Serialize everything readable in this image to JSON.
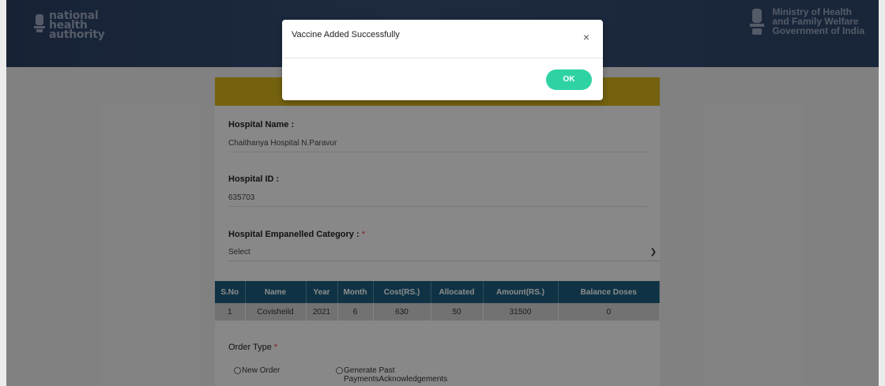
{
  "header": {
    "nha_logo_lines": [
      "national",
      "health",
      "authority"
    ],
    "ministry_lines": [
      "Ministry of Health",
      "and Family Welfare",
      "Government of India"
    ]
  },
  "form": {
    "hospital_name_label": "Hospital Name :",
    "hospital_name_value": "Chaithanya Hospital N.Paravur",
    "hospital_id_label": "Hospital ID :",
    "hospital_id_value": "635703",
    "category_label": "Hospital Empanelled Category :",
    "category_required": "*",
    "category_value": "Select",
    "table": {
      "headers": [
        "S.No",
        "Name",
        "Year",
        "Month",
        "Cost(RS.)",
        "Allocated",
        "Amount(RS.)",
        "Balance Doses"
      ],
      "rows": [
        [
          "1",
          "Covisheild",
          "2021",
          "6",
          "630",
          "50",
          "31500",
          "0"
        ]
      ]
    },
    "order_type_label": "Order Type",
    "order_type_required": "*",
    "order_options": [
      "New Order",
      "Generate Past",
      "PaymentsAcknowledgements"
    ]
  },
  "modal": {
    "title": "Vaccine Added Successfully",
    "close_symbol": "×",
    "ok_label": "OK"
  },
  "colors": {
    "header": "#2e4468",
    "band": "#d4b21c",
    "table_header": "#1d5d7d",
    "ok_button": "#2ed3a4"
  }
}
